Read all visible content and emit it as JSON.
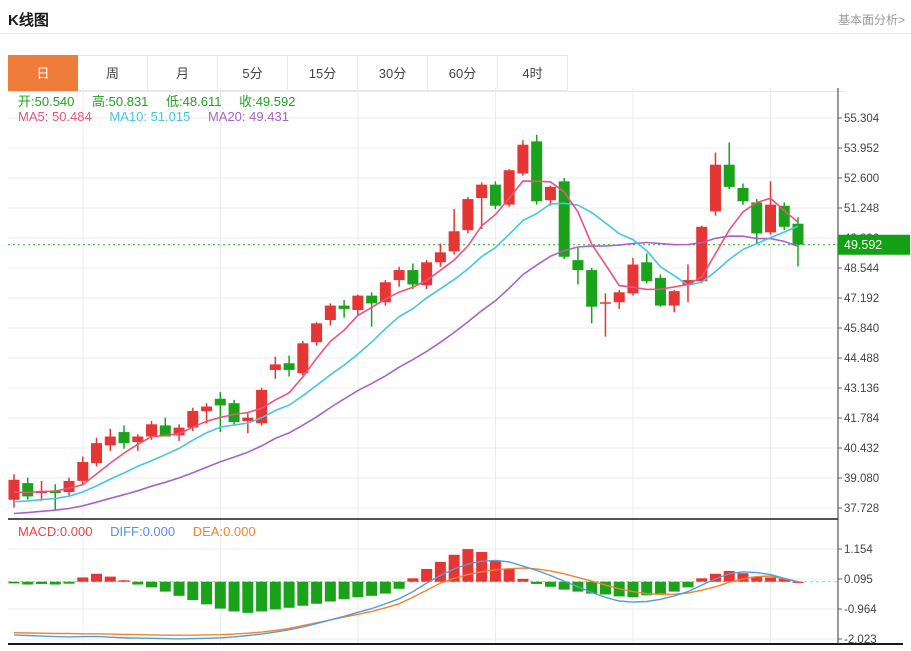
{
  "header": {
    "title": "K线图",
    "link": "基本面分析>"
  },
  "tabs": {
    "items": [
      "日",
      "周",
      "月",
      "5分",
      "15分",
      "30分",
      "60分",
      "4时"
    ],
    "active": "日",
    "active_index": 0
  },
  "info": {
    "open_label": "开:",
    "open": "50.540",
    "high_label": "高:",
    "high": "50.831",
    "low_label": "低:",
    "low": "48.611",
    "close_label": "收:",
    "close": "49.592",
    "ma5_label": "MA5:",
    "ma5": "50.484",
    "ma10_label": "MA10:",
    "ma10": "51.015",
    "ma20_label": "MA20:",
    "ma20": "49.431",
    "macd_label": "MACD:",
    "macd": "0.000",
    "diff_label": "DIFF:",
    "diff": "0.000",
    "dea_label": "DEA:",
    "dea": "0.000"
  },
  "price_marker": {
    "value": "49.592"
  },
  "chart_data": {
    "type": "candlestick+macd",
    "up_color": "#e53535",
    "down_color": "#1aa31a",
    "ma5_color": "#e8537f",
    "ma10_color": "#45c5e5",
    "ma20_color": "#a863c8",
    "diff_color": "#5b9bd5",
    "dea_color": "#ef8432",
    "marker_bg": "#12a112",
    "grid_color": "#ececec",
    "current_price": 49.592,
    "y_ticks": [
      55.304,
      53.952,
      52.6,
      51.248,
      49.896,
      48.544,
      47.192,
      45.84,
      44.488,
      43.136,
      41.784,
      40.432,
      39.08,
      37.728
    ],
    "macd_ticks": [
      1.154,
      0.095,
      -0.964,
      -2.023
    ],
    "ma_seeds": {
      "ma5": 38.3,
      "ma10": 37.9,
      "ma20": 37.4
    },
    "candles": [
      [
        38.1,
        39.25,
        37.75,
        39.0
      ],
      [
        38.85,
        39.1,
        38.1,
        38.25
      ],
      [
        38.4,
        38.95,
        38.05,
        38.5
      ],
      [
        38.5,
        38.8,
        37.6,
        38.4
      ],
      [
        38.45,
        39.1,
        38.3,
        38.95
      ],
      [
        38.95,
        40.05,
        38.8,
        39.8
      ],
      [
        39.75,
        40.9,
        39.6,
        40.65
      ],
      [
        40.55,
        41.3,
        40.3,
        40.95
      ],
      [
        41.15,
        41.45,
        40.4,
        40.65
      ],
      [
        40.7,
        41.05,
        40.3,
        40.95
      ],
      [
        40.95,
        41.65,
        40.8,
        41.5
      ],
      [
        41.45,
        41.8,
        41.0,
        40.95
      ],
      [
        41.0,
        41.5,
        40.75,
        41.35
      ],
      [
        41.35,
        42.25,
        41.2,
        42.1
      ],
      [
        42.1,
        42.45,
        41.55,
        42.3
      ],
      [
        42.65,
        42.95,
        41.15,
        42.35
      ],
      [
        42.45,
        42.6,
        41.5,
        41.6
      ],
      [
        41.65,
        42.0,
        41.1,
        41.8
      ],
      [
        41.55,
        43.15,
        41.45,
        43.05
      ],
      [
        43.95,
        44.55,
        43.55,
        44.2
      ],
      [
        44.25,
        44.6,
        43.65,
        43.95
      ],
      [
        43.8,
        45.25,
        43.7,
        45.15
      ],
      [
        45.2,
        46.1,
        45.05,
        46.05
      ],
      [
        46.2,
        46.95,
        45.95,
        46.85
      ],
      [
        46.85,
        47.1,
        46.3,
        46.7
      ],
      [
        46.65,
        47.35,
        46.4,
        47.3
      ],
      [
        47.3,
        47.45,
        45.9,
        46.95
      ],
      [
        47.0,
        48.0,
        46.85,
        47.9
      ],
      [
        48.0,
        48.6,
        47.7,
        48.45
      ],
      [
        48.45,
        48.75,
        47.6,
        47.8
      ],
      [
        47.77,
        48.9,
        47.6,
        48.8
      ],
      [
        48.8,
        49.65,
        48.6,
        49.25
      ],
      [
        49.3,
        51.2,
        49.15,
        50.2
      ],
      [
        50.25,
        51.75,
        50.1,
        51.65
      ],
      [
        51.7,
        52.4,
        50.3,
        52.3
      ],
      [
        52.3,
        52.45,
        51.2,
        51.35
      ],
      [
        51.4,
        53.0,
        51.3,
        52.95
      ],
      [
        52.8,
        54.3,
        52.7,
        54.1
      ],
      [
        54.25,
        54.55,
        51.4,
        51.55
      ],
      [
        51.6,
        52.25,
        51.35,
        52.2
      ],
      [
        52.45,
        52.6,
        48.95,
        49.05
      ],
      [
        48.9,
        49.45,
        47.8,
        48.45
      ],
      [
        48.45,
        48.55,
        46.05,
        46.8
      ],
      [
        46.95,
        47.4,
        45.45,
        47.0
      ],
      [
        47.0,
        47.55,
        46.7,
        47.45
      ],
      [
        47.4,
        49.0,
        47.3,
        48.7
      ],
      [
        48.8,
        49.2,
        47.85,
        47.95
      ],
      [
        48.1,
        48.25,
        46.8,
        46.85
      ],
      [
        46.85,
        47.55,
        46.55,
        47.5
      ],
      [
        47.8,
        48.7,
        47.0,
        48.0
      ],
      [
        47.95,
        50.45,
        47.85,
        50.4
      ],
      [
        51.1,
        53.75,
        50.9,
        53.2
      ],
      [
        53.2,
        54.2,
        52.1,
        52.2
      ],
      [
        52.15,
        52.35,
        51.4,
        51.55
      ],
      [
        51.5,
        51.65,
        49.6,
        50.1
      ],
      [
        50.15,
        52.45,
        50.05,
        51.4
      ],
      [
        51.35,
        51.5,
        50.25,
        50.4
      ],
      [
        50.54,
        50.831,
        48.611,
        49.592
      ]
    ],
    "macd_hist": [
      -0.06,
      -0.1,
      -0.08,
      -0.1,
      -0.07,
      0.15,
      0.28,
      0.18,
      0.05,
      -0.1,
      -0.2,
      -0.35,
      -0.5,
      -0.65,
      -0.8,
      -0.95,
      -1.05,
      -1.1,
      -1.05,
      -0.98,
      -0.92,
      -0.85,
      -0.78,
      -0.7,
      -0.62,
      -0.55,
      -0.5,
      -0.42,
      -0.25,
      0.12,
      0.45,
      0.7,
      0.95,
      1.15,
      1.05,
      0.75,
      0.45,
      0.1,
      -0.08,
      -0.18,
      -0.28,
      -0.35,
      -0.42,
      -0.45,
      -0.52,
      -0.55,
      -0.48,
      -0.42,
      -0.35,
      -0.2,
      0.12,
      0.28,
      0.38,
      0.3,
      0.18,
      0.15,
      0.1,
      0.0
    ],
    "macd_diff": [
      -1.88,
      -1.9,
      -1.92,
      -1.94,
      -1.95,
      -1.94,
      -1.93,
      -1.96,
      -1.98,
      -1.99,
      -2.0,
      -2.01,
      -2.02,
      -2.01,
      -2.0,
      -1.98,
      -1.95,
      -1.9,
      -1.85,
      -1.78,
      -1.7,
      -1.6,
      -1.48,
      -1.35,
      -1.22,
      -1.08,
      -0.95,
      -0.78,
      -0.6,
      -0.35,
      -0.05,
      0.22,
      0.45,
      0.62,
      0.72,
      0.75,
      0.7,
      0.55,
      0.4,
      0.22,
      0.02,
      -0.18,
      -0.38,
      -0.55,
      -0.68,
      -0.72,
      -0.7,
      -0.62,
      -0.5,
      -0.35,
      -0.12,
      0.1,
      0.28,
      0.35,
      0.32,
      0.25,
      0.12,
      0.0
    ],
    "macd_dea": [
      -1.8,
      -1.81,
      -1.82,
      -1.83,
      -1.83,
      -1.84,
      -1.84,
      -1.85,
      -1.86,
      -1.87,
      -1.88,
      -1.89,
      -1.89,
      -1.89,
      -1.88,
      -1.87,
      -1.85,
      -1.82,
      -1.78,
      -1.72,
      -1.65,
      -1.55,
      -1.45,
      -1.35,
      -1.25,
      -1.15,
      -1.05,
      -0.92,
      -0.78,
      -0.55,
      -0.3,
      -0.05,
      0.12,
      0.25,
      0.35,
      0.42,
      0.46,
      0.48,
      0.45,
      0.38,
      0.28,
      0.15,
      0.02,
      -0.12,
      -0.25,
      -0.35,
      -0.42,
      -0.45,
      -0.44,
      -0.4,
      -0.3,
      -0.18,
      -0.02,
      0.1,
      0.18,
      0.2,
      0.1,
      0.0
    ]
  }
}
